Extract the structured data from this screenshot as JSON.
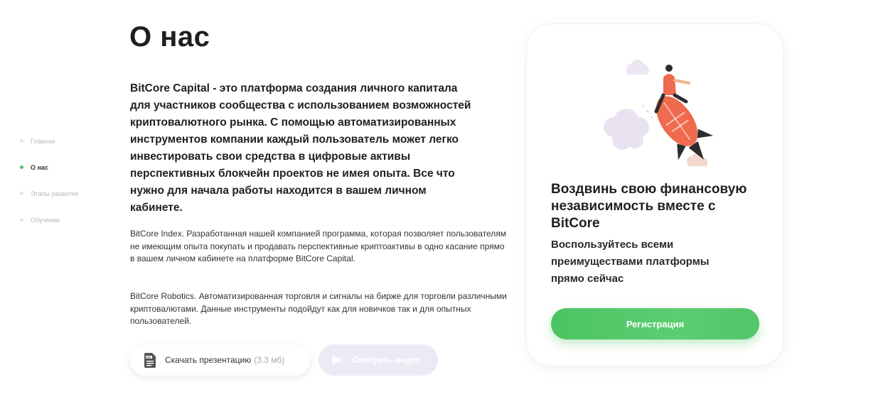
{
  "nav": {
    "items": [
      {
        "label": "Главная",
        "active": false
      },
      {
        "label": "О нас",
        "active": true
      },
      {
        "label": "Этапы развития",
        "active": false
      },
      {
        "label": "Обучение",
        "active": false
      }
    ]
  },
  "main": {
    "title": "О нас",
    "lead": "BitCore Capital - это платформа создания личного капитала для участников сообщества с использованием возможностей криптовалютного рынка. С помощью автоматизированных инструментов компании каждый пользователь может легко инвестировать свои средства в цифровые активы перспективных блокчейн проектов не имея опыта. Все что нужно для начала работы находится в вашем личном кабинете.",
    "paragraph_1": "BitCore Index. Разработанная нашей компанией программа, которая позволяет пользователям не имеющим опыта покупать и продавать перспективные криптоактивы в одно касание прямо в вашем личном кабинете на платформе BitCore Capital.",
    "paragraph_2": "BitCore Robotics. Автоматизированная торговля и сигналы на бирже для торговли различными криптовалютами. Данные инструменты подойдут как для новичков так и для опытных пользователей.",
    "download_label": "Скачать презентацию",
    "download_size": "(3.3 мб)",
    "video_label": "Смотреть видео"
  },
  "card": {
    "title": "Воздвинь свою финансовую независимость вместе с BitCore",
    "subtitle": "Воспользуйтесь всеми преимуществами платформы прямо сейчас",
    "register_label": "Регистрация"
  },
  "icons": {
    "download": "pdf-icon",
    "video": "play-icon",
    "illustration": "rocket-rider-illustration"
  },
  "colors": {
    "accent": "#4bc462",
    "text": "#1f1f1f",
    "muted": "#b9b9b9",
    "video_button": "#ecebf5"
  }
}
